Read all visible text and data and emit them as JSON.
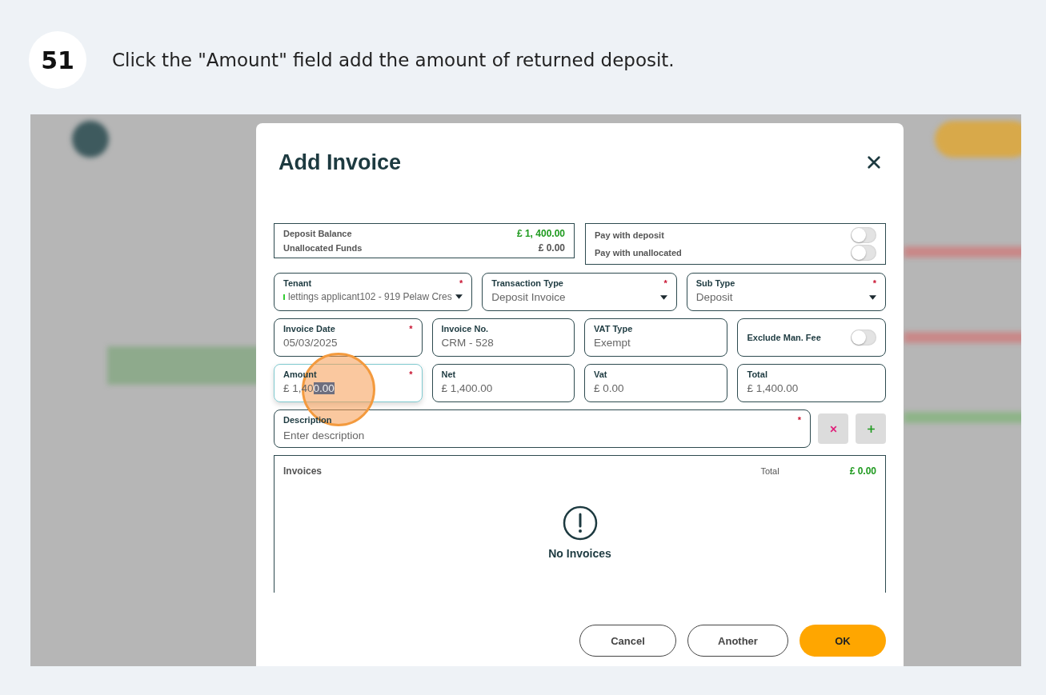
{
  "step": {
    "number": "51",
    "instruction": "Click the \"Amount\" field add the amount of returned deposit."
  },
  "dialog": {
    "title": "Add Invoice",
    "balances": [
      {
        "label": "Deposit Balance",
        "value": "£ 1, 400.00",
        "color": "#1f9a1f"
      },
      {
        "label": "Unallocated Funds",
        "value": "£ 0.00",
        "color": "#555555"
      }
    ],
    "payment_toggles": [
      {
        "label": "Pay with deposit",
        "on": false
      },
      {
        "label": "Pay with unallocated",
        "on": false
      }
    ],
    "field_rows": [
      [
        {
          "kind": "select",
          "label": "Tenant",
          "required_mark": "*",
          "value": "lettings applicant102 - 919 Pelaw Cres",
          "marker": true,
          "focused": false
        },
        {
          "kind": "select",
          "label": "Transaction Type",
          "required_mark": "*",
          "value": "Deposit Invoice",
          "marker": false,
          "focused": false
        },
        {
          "kind": "select",
          "label": "Sub Type",
          "required_mark": "*",
          "value": "Deposit",
          "marker": false,
          "focused": false
        }
      ],
      [
        {
          "kind": "text",
          "label": "Invoice Date",
          "required_mark": "*",
          "value": "05/03/2025",
          "focused": false
        },
        {
          "kind": "text",
          "label": "Invoice No.",
          "value": "CRM - 528",
          "focused": false
        },
        {
          "kind": "text",
          "label": "VAT Type",
          "value": "Exempt",
          "focused": false
        },
        {
          "kind": "toggle",
          "label": "Exclude Man. Fee",
          "on": false
        }
      ],
      [
        {
          "kind": "text",
          "label": "Amount",
          "required_mark": "*",
          "value": "£ 1,40",
          "selected_text": "0.00",
          "focused": true
        },
        {
          "kind": "text",
          "label": "Net",
          "value": "£ 1,400.00",
          "focused": false
        },
        {
          "kind": "text",
          "label": "Vat",
          "value": "£ 0.00",
          "focused": false
        },
        {
          "kind": "text",
          "label": "Total",
          "value": "£ 1,400.00",
          "focused": false
        }
      ]
    ],
    "description": {
      "label": "Description",
      "required_mark": "*",
      "placeholder": "Enter description"
    },
    "invoices": {
      "title": "Invoices",
      "total_label": "Total",
      "total": "£ 0.00",
      "empty_text": "No Invoices"
    },
    "buttons": [
      {
        "label": "Cancel",
        "kind": "outline"
      },
      {
        "label": "Another",
        "kind": "outline"
      },
      {
        "label": "OK",
        "kind": "primary"
      }
    ]
  }
}
